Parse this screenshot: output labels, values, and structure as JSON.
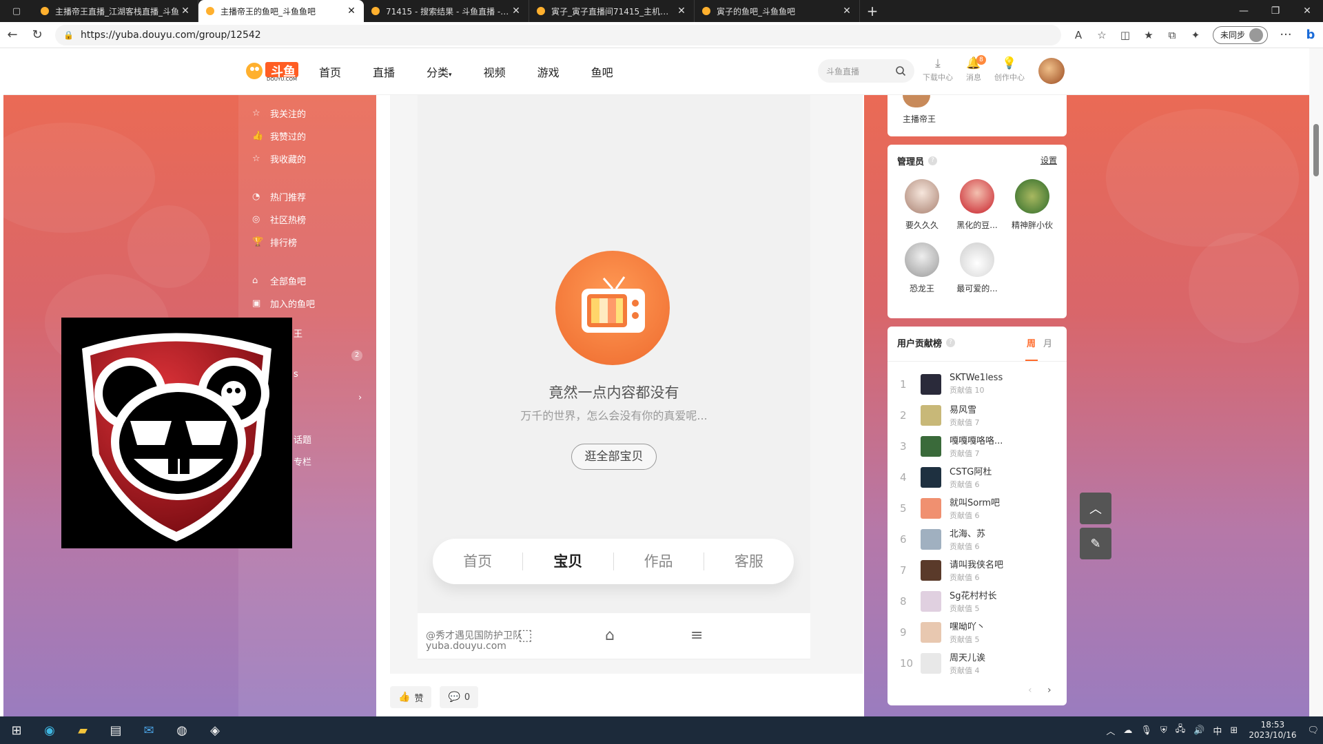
{
  "browser": {
    "tabs": [
      {
        "title": "主播帝王直播_江湖客栈直播_斗鱼",
        "active": false
      },
      {
        "title": "主播帝王的鱼吧_斗鱼鱼吧",
        "active": true
      },
      {
        "title": "71415 - 搜索结果 - 斗鱼直播 - 游",
        "active": false
      },
      {
        "title": "寅子_寅子直播间71415_主机游戏",
        "active": false
      },
      {
        "title": "寅子的鱼吧_斗鱼鱼吧",
        "active": false
      }
    ],
    "url": "https://yuba.douyu.com/group/12542",
    "sync_label": "未同步"
  },
  "header": {
    "logo_text": "斗鱼",
    "logo_sub": "DOUYU.COM",
    "nav": [
      "首页",
      "直播",
      "分类",
      "视频",
      "游戏",
      "鱼吧"
    ],
    "search_placeholder": "斗鱼直播",
    "icons": [
      {
        "name": "download-icon",
        "label": "下载中心"
      },
      {
        "name": "bell-icon",
        "label": "消息",
        "badge": "8"
      },
      {
        "name": "bulb-icon",
        "label": "创作中心"
      }
    ]
  },
  "leftnav": {
    "items": [
      {
        "icon": "star-icon",
        "label": "我关注的"
      },
      {
        "icon": "thumb-icon",
        "label": "我赞过的"
      },
      {
        "icon": "bookmark-icon",
        "label": "我收藏的"
      },
      {
        "icon": "fire-icon",
        "label": "热门推荐"
      },
      {
        "icon": "hot-icon",
        "label": "社区热榜"
      },
      {
        "icon": "trophy-icon",
        "label": "排行榜"
      },
      {
        "icon": "home-icon",
        "label": "全部鱼吧"
      },
      {
        "icon": "join-icon",
        "label": "加入的鱼吧"
      }
    ],
    "partials": [
      "王",
      "s",
      "话题",
      "专栏"
    ],
    "badge": "2"
  },
  "main": {
    "empty_title": "竟然一点内容都没有",
    "empty_sub": "万千的世界，怎么会没有你的真爱呢...",
    "browse_button": "逛全部宝贝",
    "phone_tabs": [
      "首页",
      "宝贝",
      "作品",
      "客服"
    ],
    "active_phone_tab": "宝贝",
    "watermark_line1": "@秀才遇见国防护卫队",
    "watermark_line2": "yuba.douyu.com",
    "like_label": "赞",
    "comment_count": "0"
  },
  "right": {
    "top_card_name": "主播帝王",
    "admins_title": "管理员",
    "admins_action": "设置",
    "admins": [
      {
        "name": "要久久久",
        "color": "#d9c9c0"
      },
      {
        "name": "黑化的豆...",
        "color": "#c8202a"
      },
      {
        "name": "精神胖小伙",
        "color": "#2e6b2a"
      },
      {
        "name": "恐龙王",
        "color": "#cfcfcf"
      },
      {
        "name": "最可爱的...",
        "color": "#f0f0f0"
      }
    ],
    "rank_title": "用户贡献榜",
    "rank_tabs": [
      "周",
      "月"
    ],
    "rank_score_label": "贡献值",
    "ranks": [
      {
        "no": "1",
        "name": "SKTWe1less",
        "score": "10",
        "color": "#2a2a3a"
      },
      {
        "no": "2",
        "name": "易风雪",
        "score": "7",
        "color": "#c8b878"
      },
      {
        "no": "3",
        "name": "嘎嘎嘎咯咯...",
        "score": "7",
        "color": "#3a6a3a"
      },
      {
        "no": "4",
        "name": "CSTG阿杜",
        "score": "6",
        "color": "#1e3040"
      },
      {
        "no": "5",
        "name": "就叫Sorm吧",
        "score": "6",
        "color": "#f09070"
      },
      {
        "no": "6",
        "name": "北海、苏",
        "score": "6",
        "color": "#a0b0c0"
      },
      {
        "no": "7",
        "name": "请叫我侠名吧",
        "score": "6",
        "color": "#5a3a2a"
      },
      {
        "no": "8",
        "name": "Sg花村村长",
        "score": "5",
        "color": "#e0d0e0"
      },
      {
        "no": "9",
        "name": "嘿呦吖丶",
        "score": "5",
        "color": "#e8c8b0"
      },
      {
        "no": "10",
        "name": "周天儿诶",
        "score": "4",
        "color": "#e8e8e8"
      }
    ]
  },
  "taskbar": {
    "time": "18:53",
    "date": "2023/10/16",
    "ime": "中"
  },
  "colors": {
    "accent": "#ff6a2a",
    "bg_top": "#ea6a55",
    "bg_bottom": "#9a7cbf"
  }
}
